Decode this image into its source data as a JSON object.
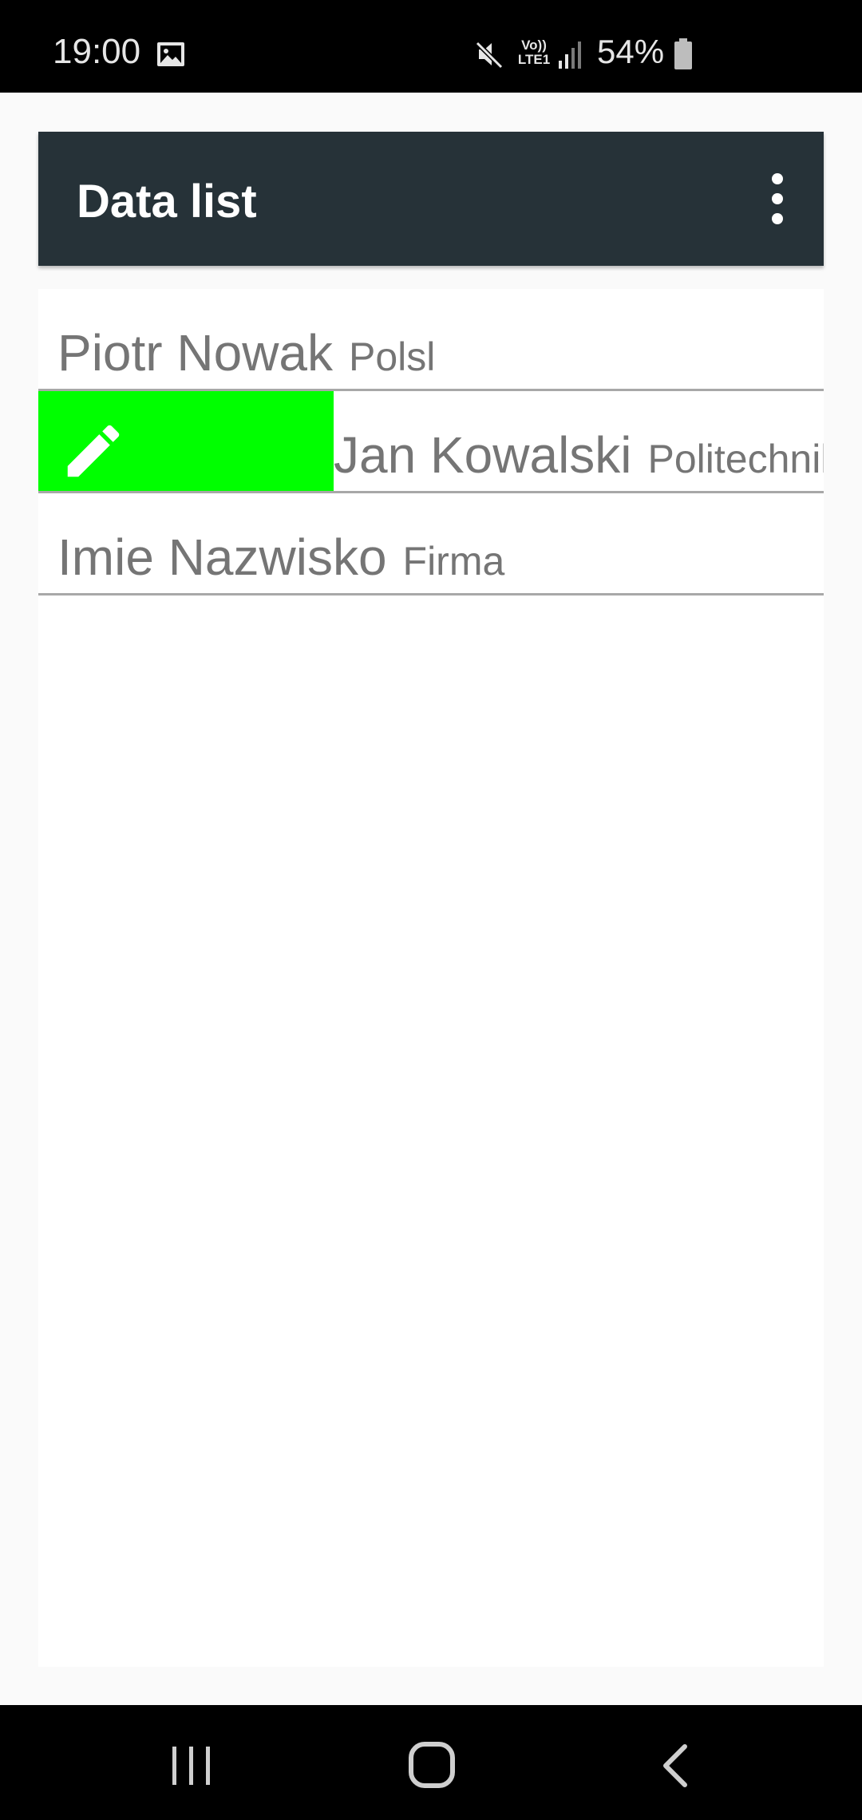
{
  "status_bar": {
    "time": "19:00",
    "volte_line1": "Vo))",
    "volte_line2": "LTE1",
    "battery": "54%",
    "icons": [
      "image-icon",
      "mute-icon",
      "volte-icon",
      "signal-icon",
      "battery-icon"
    ]
  },
  "app_bar": {
    "title": "Data list",
    "menu_icon": "more-vert-icon"
  },
  "list": {
    "items": [
      {
        "name": "Piotr Nowak",
        "company": "Polsl"
      },
      {
        "name": "Jan Kowalski",
        "company": "Politechnika",
        "swipe_action_icon": "edit-icon",
        "swipe_action_color": "#00ff00"
      },
      {
        "name": "Imie Nazwisko",
        "company": "Firma"
      }
    ]
  },
  "nav_bar": {
    "icons": [
      "recent-apps-icon",
      "home-icon",
      "back-icon"
    ]
  },
  "colors": {
    "app_bar": "#263238",
    "swipe_action": "#00ff00",
    "item_text": "#757575"
  }
}
